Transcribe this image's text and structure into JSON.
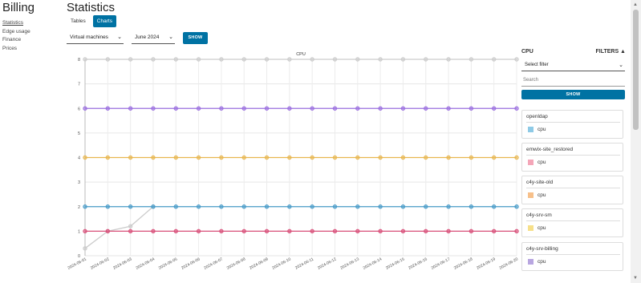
{
  "app": {
    "title": "Billing"
  },
  "nav": {
    "items": [
      {
        "label": "Statistics",
        "active": true
      },
      {
        "label": "Edge usage"
      },
      {
        "label": "Finance"
      },
      {
        "label": "Prices"
      }
    ]
  },
  "page": {
    "title": "Statistics"
  },
  "tabs": [
    {
      "label": "Tables"
    },
    {
      "label": "Charts",
      "active": true
    }
  ],
  "controls": {
    "resource_select": "Virtual machines",
    "period_select": "June 2024",
    "show_label": "SHOW"
  },
  "sidebar": {
    "title": "CPU",
    "filters_label": "FILTERS ▲",
    "filter_select": "Select filter",
    "search_placeholder": "Search",
    "show_label": "SHOW",
    "cards": [
      {
        "name": "openldap",
        "series": "cpu",
        "color": "#8ecae6"
      },
      {
        "name": "emwix-site_restored",
        "series": "cpu",
        "color": "#f4a6b8"
      },
      {
        "name": "c4y-site-old",
        "series": "cpu",
        "color": "#f7c08a"
      },
      {
        "name": "c4y-srv-sm",
        "series": "cpu",
        "color": "#f7e08a"
      },
      {
        "name": "c4y-srv-billing",
        "series": "cpu",
        "color": "#b8a6e0"
      }
    ]
  },
  "chart_data": {
    "type": "line",
    "title": "CPU",
    "ylim": [
      0,
      8
    ],
    "y_ticks": [
      "0",
      "1",
      "2",
      "3",
      "4",
      "5",
      "6",
      "7",
      "8"
    ],
    "x": [
      "2024-06-01",
      "2024-06-02",
      "2024-06-03",
      "2024-06-04",
      "2024-06-05",
      "2024-06-06",
      "2024-06-07",
      "2024-06-08",
      "2024-06-09",
      "2024-06-10",
      "2024-06-11",
      "2024-06-12",
      "2024-06-13",
      "2024-06-14",
      "2024-06-15",
      "2024-06-16",
      "2024-06-17",
      "2024-06-18",
      "2024-06-19",
      "2024-06-20"
    ],
    "grid": true,
    "series": [
      {
        "color": "#cccccc",
        "values": [
          0.3,
          1.0,
          1.2,
          2,
          null,
          null,
          null,
          null,
          null,
          null,
          null,
          null,
          null,
          null,
          null,
          null,
          null,
          null,
          null,
          null
        ]
      },
      {
        "color": "#cccccc",
        "values": [
          8,
          8,
          8,
          8,
          8,
          8,
          8,
          8,
          8,
          8,
          8,
          8,
          8,
          8,
          8,
          8,
          8,
          8,
          8,
          8
        ]
      },
      {
        "color": "#9b6fe0",
        "values": [
          6,
          6,
          6,
          6,
          6,
          6,
          6,
          6,
          6,
          6,
          6,
          6,
          6,
          6,
          6,
          6,
          6,
          6,
          6,
          6
        ]
      },
      {
        "color": "#e8b64f",
        "values": [
          4,
          4,
          4,
          4,
          4,
          4,
          4,
          4,
          4,
          4,
          4,
          4,
          4,
          4,
          4,
          4,
          4,
          4,
          4,
          4
        ]
      },
      {
        "color": "#4a9cc9",
        "values": [
          2,
          2,
          2,
          2,
          2,
          2,
          2,
          2,
          2,
          2,
          2,
          2,
          2,
          2,
          2,
          2,
          2,
          2,
          2,
          2
        ]
      },
      {
        "color": "#d9507a",
        "values": [
          1,
          1,
          1,
          1,
          1,
          1,
          1,
          1,
          1,
          1,
          1,
          1,
          1,
          1,
          1,
          1,
          1,
          1,
          1,
          1
        ]
      }
    ]
  }
}
